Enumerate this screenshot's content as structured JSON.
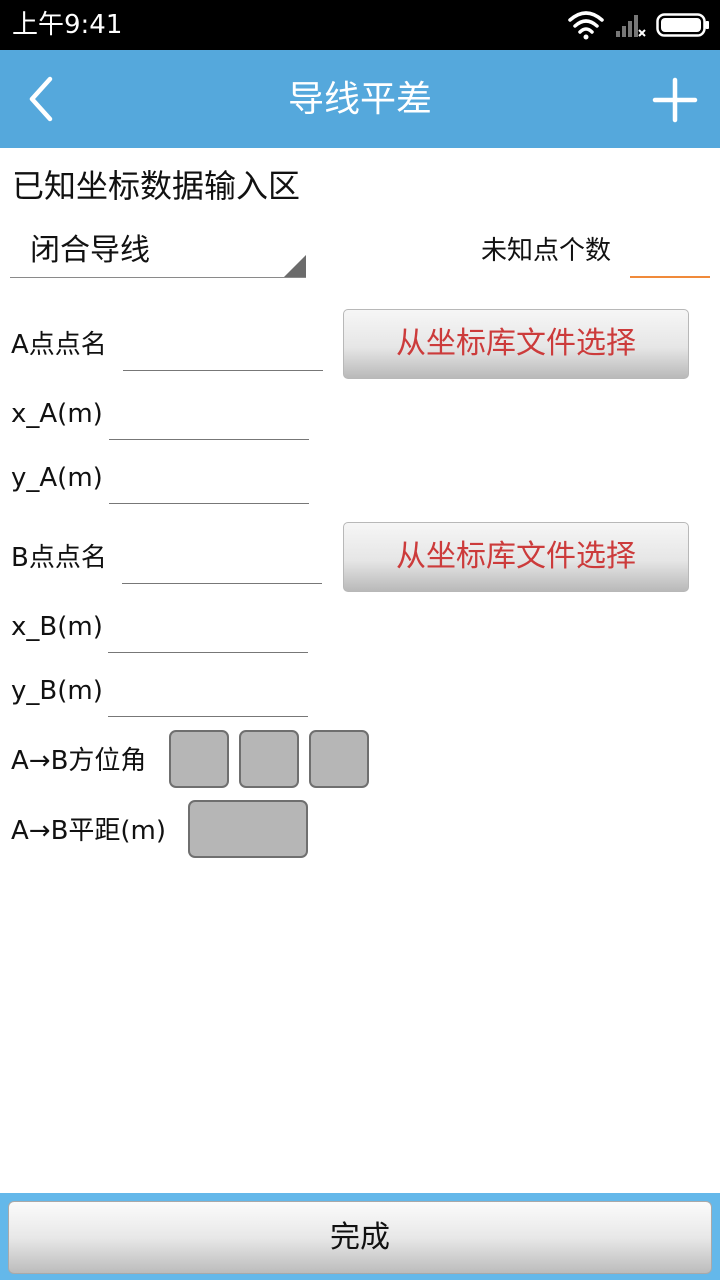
{
  "status_bar": {
    "time": "上午9:41",
    "icons": [
      "wifi-icon",
      "signal-icon",
      "battery-icon"
    ]
  },
  "header": {
    "title": "导线平差",
    "back_icon": "chevron-left-icon",
    "add_icon": "plus-icon"
  },
  "section": {
    "title": "已知坐标数据输入区"
  },
  "traverse_type": {
    "selected": "闭合导线"
  },
  "unknown_points": {
    "label": "未知点个数",
    "value": ""
  },
  "point_a": {
    "name_label": "A点点名",
    "select_button": "从坐标库文件选择",
    "x_label": "x_A(m)",
    "y_label": "y_A(m)"
  },
  "point_b": {
    "name_label": "B点点名",
    "select_button": "从坐标库文件选择",
    "x_label": "x_B(m)",
    "y_label": "y_B(m)"
  },
  "azimuth": {
    "label": "A→B方位角"
  },
  "distance": {
    "label": "A→B平距(m)"
  },
  "footer": {
    "done_label": "完成"
  },
  "colors": {
    "title_bar": "#55a8dc",
    "footer_bar": "#64b8ea",
    "button_text": "#cc3b3b",
    "input_accent": "#f08a3a"
  }
}
